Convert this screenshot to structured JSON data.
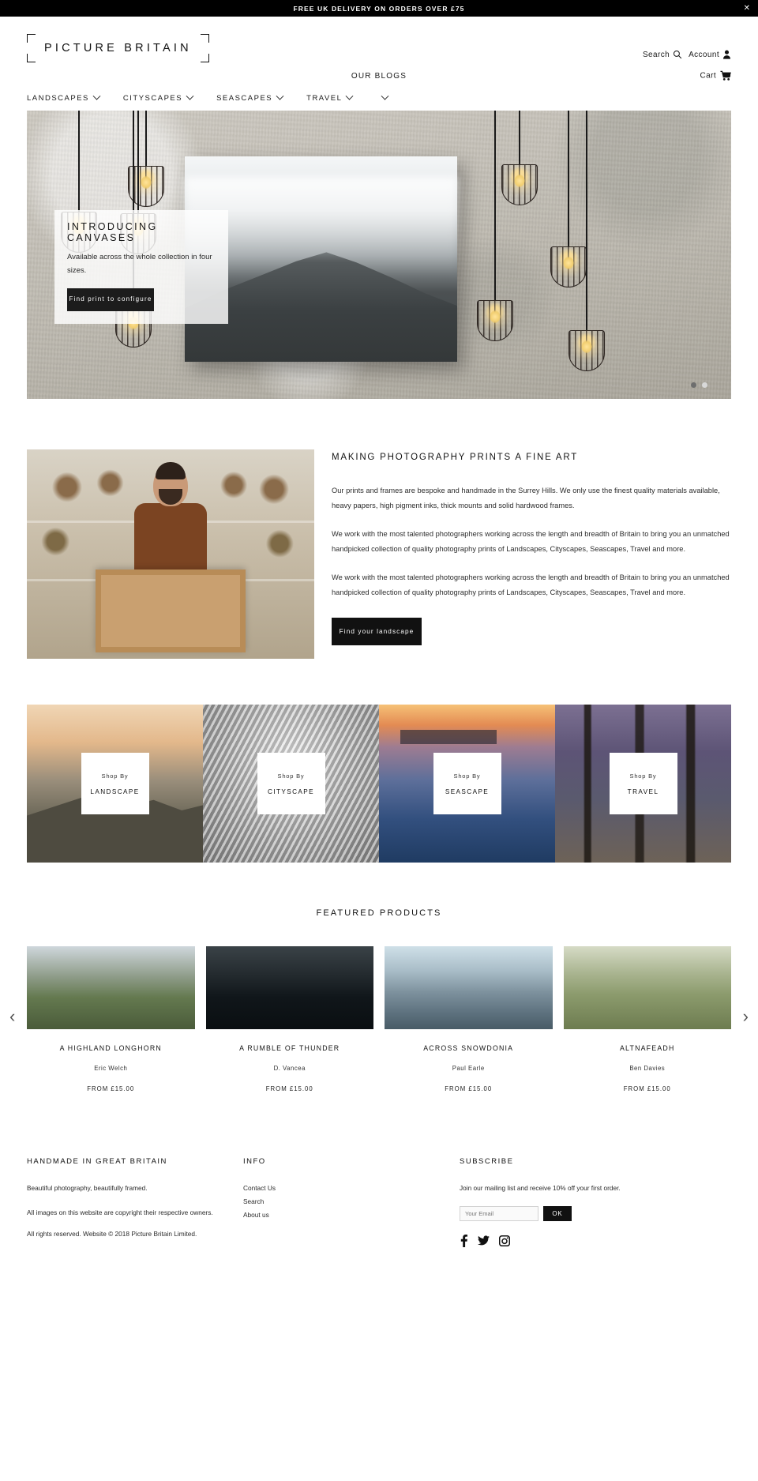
{
  "announcement": {
    "text": "FREE UK DELIVERY ON ORDERS OVER £75",
    "close_label": "✕"
  },
  "header": {
    "logo_text": "PICTURE BRITAIN",
    "search_label": "Search",
    "account_label": "Account",
    "blogs_label": "OUR BLOGS",
    "cart_label": "Cart"
  },
  "nav": {
    "items": [
      {
        "label": "LANDSCAPES",
        "has_chevron": true
      },
      {
        "label": "CITYSCAPES",
        "has_chevron": true
      },
      {
        "label": "SEASCAPES",
        "has_chevron": true
      },
      {
        "label": "TRAVEL",
        "has_chevron": true
      }
    ]
  },
  "hero": {
    "title": "INTRODUCING CANVASES",
    "subtitle": "Available across the whole collection in four sizes.",
    "button_label": "Find print to configure",
    "dots": [
      "active",
      "inactive"
    ]
  },
  "about": {
    "title": "MAKING PHOTOGRAPHY PRINTS A FINE ART",
    "paragraph_1": "Our prints and frames are bespoke and handmade in the Surrey Hills. We only use the finest quality materials available, heavy papers, high pigment inks, thick mounts and solid hardwood frames.",
    "paragraph_2": "We work with the most talented photographers working across the length and breadth of Britain to bring you an unmatched handpicked collection of quality photography prints of Landscapes, Cityscapes, Seascapes, Travel and more.",
    "paragraph_3": "We work with the most talented photographers working across the length and breadth of Britain to bring you an unmatched handpicked collection of quality photography prints of Landscapes, Cityscapes, Seascapes, Travel and more.",
    "button_label": "Find your landscape"
  },
  "categories": {
    "shop_by_label": "Shop By",
    "items": [
      {
        "name": "LANDSCAPE"
      },
      {
        "name": "CITYSCAPE"
      },
      {
        "name": "SEASCAPE"
      },
      {
        "name": "TRAVEL"
      }
    ]
  },
  "featured": {
    "heading": "FEATURED PRODUCTS",
    "prev_label": "‹",
    "next_label": "›",
    "products": [
      {
        "name": "A HIGHLAND LONGHORN",
        "artist": "Eric Welch",
        "price": "FROM £15.00"
      },
      {
        "name": "A RUMBLE OF THUNDER",
        "artist": "D. Vancea",
        "price": "FROM £15.00"
      },
      {
        "name": "ACROSS SNOWDONIA",
        "artist": "Paul Earle",
        "price": "FROM £15.00"
      },
      {
        "name": "ALTNAFEADH",
        "artist": "Ben Davies",
        "price": "FROM £15.00"
      }
    ]
  },
  "footer": {
    "col1_heading": "HANDMADE IN GREAT BRITAIN",
    "col1_line1": "Beautiful photography, beautifully framed.",
    "col1_line2": "All images on this website are copyright their respective owners.",
    "col1_line3": "All rights reserved. Website © 2018 Picture Britain Limited.",
    "col2_heading": "INFO",
    "col2_links": [
      "Contact Us",
      "Search",
      "About us"
    ],
    "col3_heading": "SUBSCRIBE",
    "col3_text": "Join our mailing list and receive 10% off your first order.",
    "email_placeholder": "Your Email",
    "subscribe_button": "OK",
    "social": [
      "facebook-icon",
      "twitter-icon",
      "instagram-icon"
    ]
  },
  "colors": {
    "accent": "#000000",
    "text": "#1a1a1a",
    "muted": "#2b2b2b"
  }
}
